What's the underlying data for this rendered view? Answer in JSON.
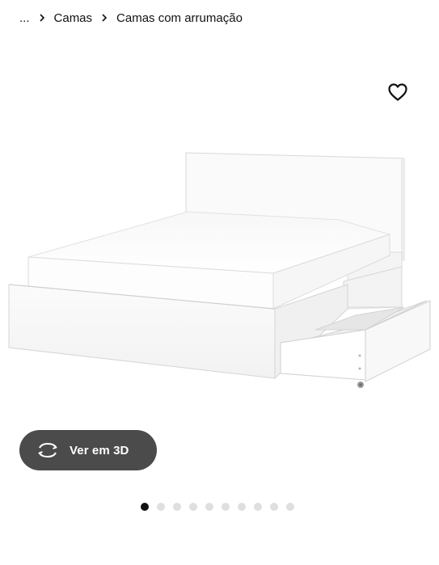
{
  "breadcrumb": {
    "ellipsis": "...",
    "items": [
      {
        "label": "Camas"
      },
      {
        "label": "Camas com arrumação"
      }
    ]
  },
  "product": {
    "favorite_icon": "heart-outline-icon",
    "image_description_icon": "bed-with-storage-drawers"
  },
  "viewer": {
    "button_label": "Ver em 3D",
    "button_icon": "rotate-3d-icon",
    "button_color": "#4b4b4b"
  },
  "carousel": {
    "total": 10,
    "active_index": 0,
    "active_color": "#111111",
    "inactive_color": "#dfdfdf"
  }
}
